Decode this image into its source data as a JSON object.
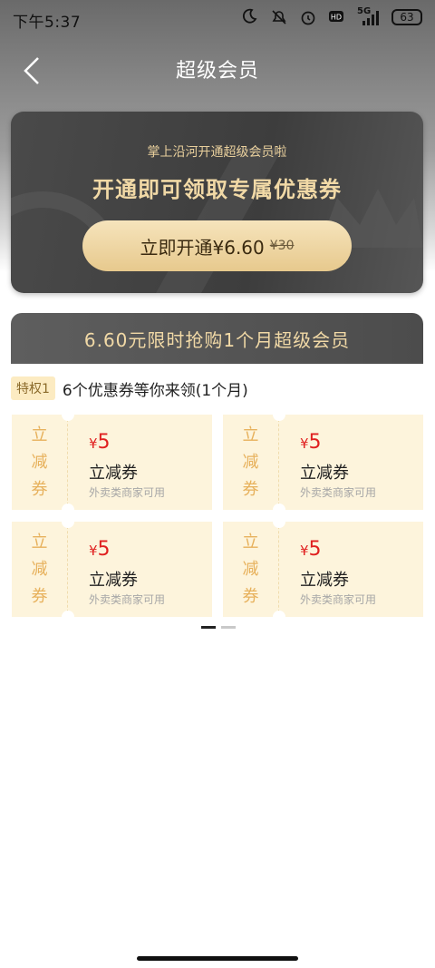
{
  "status_bar": {
    "time": "下午5:37",
    "signal_label": "5G",
    "battery": "63",
    "icons": [
      "moon-icon",
      "mute-icon",
      "alarm-icon",
      "hd-icon",
      "signal-icon",
      "battery-icon"
    ]
  },
  "header": {
    "title": "超级会员",
    "back_icon": "chevron-left-icon"
  },
  "promo": {
    "subtitle": "掌上沿河开通超级会员啦",
    "title": "开通即可领取专属优惠券",
    "button_label": "立即开通¥6.60",
    "original_price": "¥30",
    "colors": {
      "card": "#434343",
      "gold_text": "#f1d9a6",
      "button": "#efd7a6"
    }
  },
  "offer": {
    "banner": "6.60元限时抢购1个月超级会员",
    "privilege_badge": "特权1",
    "privilege_text": "6个优惠券等你来领(1个月)"
  },
  "coupons": [
    {
      "tag": [
        "立",
        "减",
        "券"
      ],
      "currency": "¥",
      "amount": "5",
      "name": "立减券",
      "desc": "外卖类商家可用"
    },
    {
      "tag": [
        "立",
        "减",
        "券"
      ],
      "currency": "¥",
      "amount": "5",
      "name": "立减券",
      "desc": "外卖类商家可用"
    },
    {
      "tag": [
        "立",
        "减",
        "券"
      ],
      "currency": "¥",
      "amount": "5",
      "name": "立减券",
      "desc": "外卖类商家可用"
    },
    {
      "tag": [
        "立",
        "减",
        "券"
      ],
      "currency": "¥",
      "amount": "5",
      "name": "立减券",
      "desc": "外卖类商家可用"
    }
  ],
  "pager": {
    "pages": 2,
    "active": 1
  }
}
